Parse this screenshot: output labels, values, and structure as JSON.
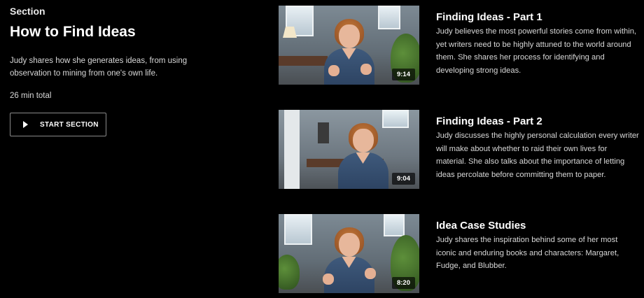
{
  "section": {
    "eyebrow": "Section",
    "title": "How to Find Ideas",
    "description": "Judy shares how she generates ideas, from using observation to mining from one's own life.",
    "total": "26 min total",
    "start_label": "START SECTION"
  },
  "lessons": [
    {
      "title": "Finding Ideas - Part 1",
      "description": "Judy believes the most powerful stories come from within, yet writers need to be highly attuned to the world around them. She shares her process for identifying and developing strong ideas.",
      "duration": "9:14"
    },
    {
      "title": "Finding Ideas - Part 2",
      "description": "Judy discusses the highly personal calculation every writer will make about whether to raid their own lives for material. She also talks about the importance of letting ideas percolate before committing them to paper.",
      "duration": "9:04"
    },
    {
      "title": "Idea Case Studies",
      "description": "Judy shares the inspiration behind some of her most iconic and enduring books and characters: Margaret, Fudge, and Blubber.",
      "duration": "8:20"
    }
  ]
}
